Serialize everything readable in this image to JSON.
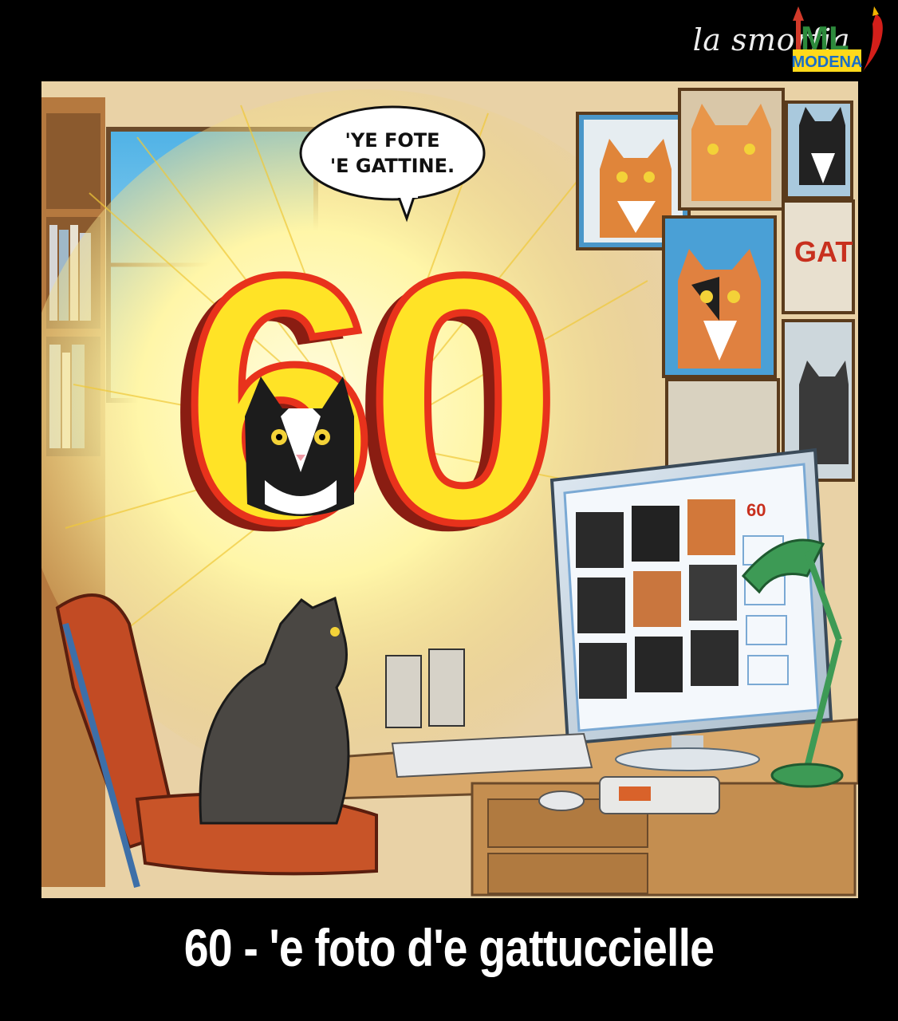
{
  "logo": {
    "brand_text": "la smorfia",
    "badge_letters": "ML",
    "badge_city": "MODENA",
    "icon": "chili-pepper-icon"
  },
  "illustration": {
    "number": "60",
    "speech_bubble": [
      "'YE FOTE",
      "'E GATTINE."
    ],
    "poster_text": "GAT",
    "screen_mini_number": "60",
    "colors": {
      "number_fill": "#ffe326",
      "number_outline": "#e8321c",
      "number_side": "#8a1d12",
      "glow": "#fff6a8",
      "desk": "#d9a86a",
      "chair": "#c24b24",
      "lamp": "#3d9a55",
      "screen": "#f4f8fc"
    }
  },
  "caption": {
    "text": "60 - 'e foto d'e gattuccielle"
  }
}
